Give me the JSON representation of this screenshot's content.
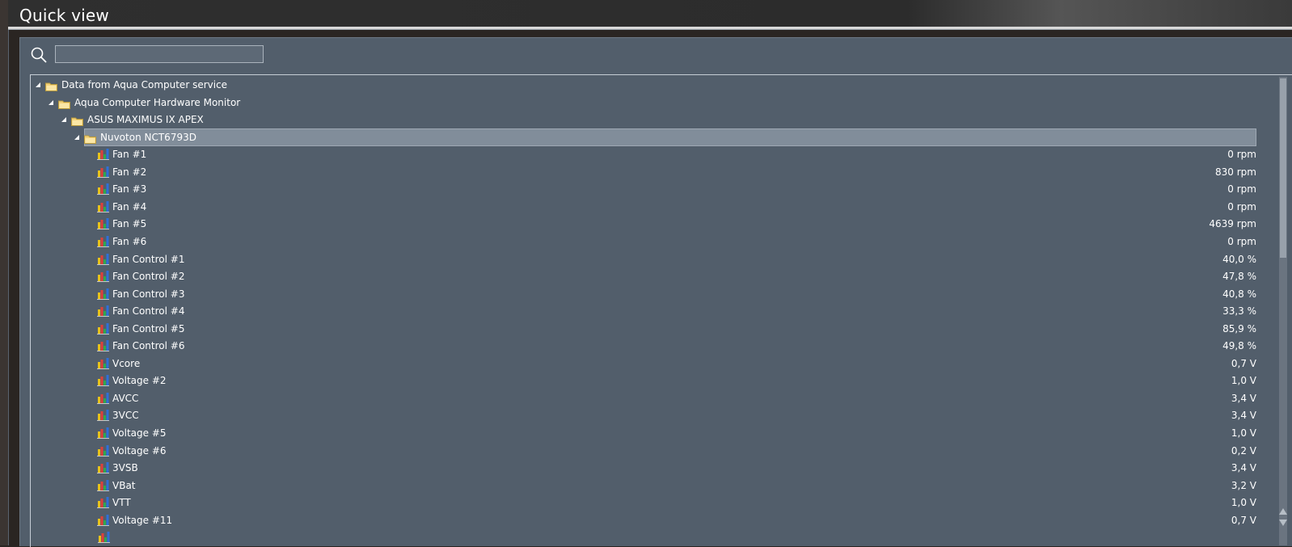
{
  "window": {
    "title": "Quick view"
  },
  "search": {
    "placeholder": "",
    "value": ""
  },
  "tree": {
    "nodes": [
      {
        "label": "Data from Aqua Computer service",
        "level": 0,
        "type": "folder",
        "expanded": true
      },
      {
        "label": "Aqua Computer Hardware Monitor",
        "level": 1,
        "type": "folder",
        "expanded": true
      },
      {
        "label": "ASUS MAXIMUS IX APEX",
        "level": 2,
        "type": "folder",
        "expanded": true
      },
      {
        "label": "Nuvoton NCT6793D",
        "level": 3,
        "type": "folder",
        "expanded": true,
        "selected": true
      }
    ],
    "sensors": [
      {
        "label": "Fan #1",
        "value": "0 rpm"
      },
      {
        "label": "Fan #2",
        "value": "830 rpm"
      },
      {
        "label": "Fan #3",
        "value": "0 rpm"
      },
      {
        "label": "Fan #4",
        "value": "0 rpm"
      },
      {
        "label": "Fan #5",
        "value": "4639 rpm"
      },
      {
        "label": "Fan #6",
        "value": "0 rpm"
      },
      {
        "label": "Fan Control #1",
        "value": "40,0 %"
      },
      {
        "label": "Fan Control #2",
        "value": "47,8 %"
      },
      {
        "label": "Fan Control #3",
        "value": "40,8 %"
      },
      {
        "label": "Fan Control #4",
        "value": "33,3 %"
      },
      {
        "label": "Fan Control #5",
        "value": "85,9 %"
      },
      {
        "label": "Fan Control #6",
        "value": "49,8 %"
      },
      {
        "label": "Vcore",
        "value": "0,7 V"
      },
      {
        "label": "Voltage #2",
        "value": "1,0 V"
      },
      {
        "label": "AVCC",
        "value": "3,4 V"
      },
      {
        "label": "3VCC",
        "value": "3,4 V"
      },
      {
        "label": "Voltage #5",
        "value": "1,0 V"
      },
      {
        "label": "Voltage #6",
        "value": "0,2 V"
      },
      {
        "label": "3VSB",
        "value": "3,4 V"
      },
      {
        "label": "VBat",
        "value": "3,2 V"
      },
      {
        "label": "VTT",
        "value": "1,0 V"
      },
      {
        "label": "Voltage #11",
        "value": "0,7 V"
      }
    ]
  },
  "icons": {
    "search": "search-icon",
    "folder": "folder-icon",
    "sensor": "bar-chart-icon",
    "expand": "expanded-triangle-icon"
  },
  "colors": {
    "panel": "#525e6b",
    "selection": "#818d9a",
    "folder": "#f3d27a",
    "bar_red": "#e0403a",
    "bar_yellow": "#e8c21a",
    "bar_green": "#2fa84f",
    "bar_blue": "#2f6fd8"
  }
}
